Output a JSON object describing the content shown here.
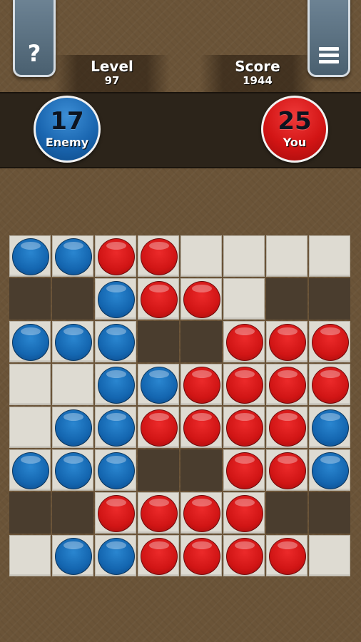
{
  "header": {
    "help_button": {
      "icon": "question-icon",
      "glyph": "?"
    },
    "menu_button": {
      "icon": "hamburger-menu-icon"
    },
    "level": {
      "label": "Level",
      "value": "97"
    },
    "score": {
      "label": "Score",
      "value": "1944"
    }
  },
  "players": {
    "enemy": {
      "count": "17",
      "label": "Enemy",
      "color": "#1a66b0"
    },
    "you": {
      "count": "25",
      "label": "You",
      "color": "#d31515"
    }
  },
  "board": {
    "legend": {
      "B": "blue disc (enemy)",
      "R": "red disc (you)",
      "E": "empty tile",
      "H": "hole (no tile)"
    },
    "rows": [
      "BBRREEEE",
      "HHBRREHH",
      "BBBHHRRR",
      "EEBBRRRR",
      "EBBRRRRB",
      "BBBHHRRB",
      "HHRRRRHH",
      "EBBRRRRE"
    ]
  }
}
